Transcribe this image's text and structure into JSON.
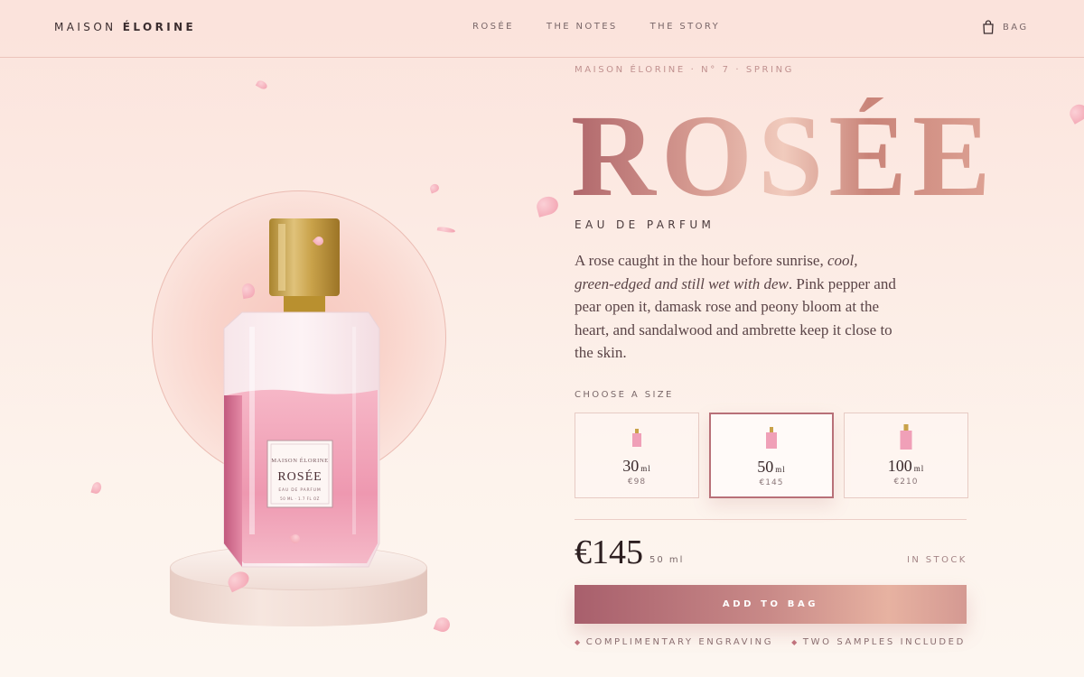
{
  "nav": {
    "brand_light": "MAISON ",
    "brand_bold": "ÉLORINE",
    "links": [
      "ROSÉE",
      "THE NOTES",
      "THE STORY"
    ],
    "bag_label": "BAG"
  },
  "bottle_label": {
    "house": "MAISON ÉLORINE",
    "name": "ROSÉE",
    "type": "EAU DE PARFUM",
    "volume": "50 ML · 1.7 FL OZ"
  },
  "product": {
    "eyebrow": "MAISON ÉLORINE · N° 7 · SPRING",
    "title": "ROSÉE",
    "subtitle": "EAU DE PARFUM",
    "desc_part1": "A rose caught in the hour before sunrise, ",
    "desc_italic": "cool, green-edged and still wet with dew",
    "desc_part2": ". Pink pepper and pear open it, damask rose and peony bloom at the heart, and sandalwood and ambrette keep it close to the skin."
  },
  "sizes": {
    "label": "CHOOSE A SIZE",
    "options": [
      {
        "volume": "30",
        "unit": "ml",
        "price": "€98",
        "selected": false
      },
      {
        "volume": "50",
        "unit": "ml",
        "price": "€145",
        "selected": true
      },
      {
        "volume": "100",
        "unit": "ml",
        "price": "€210",
        "selected": false
      }
    ]
  },
  "purchase": {
    "price": "€145",
    "volume": "50 ml",
    "stock": "IN STOCK",
    "cta": "ADD TO BAG",
    "perks": [
      "COMPLIMENTARY ENGRAVING",
      "TWO SAMPLES INCLUDED"
    ]
  },
  "colors": {
    "accent": "#b87078",
    "rose_gold": "#d79c92",
    "background": "#fbe3dc"
  }
}
